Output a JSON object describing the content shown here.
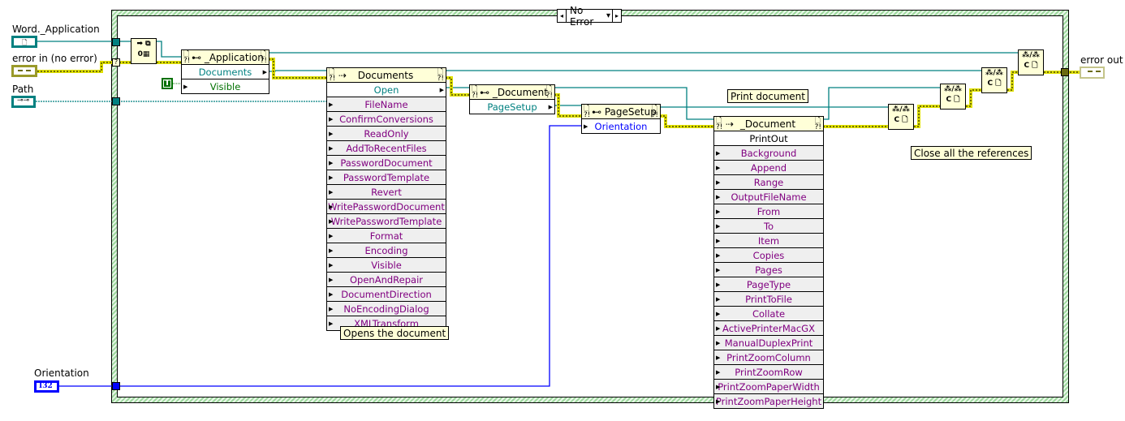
{
  "case_structure": {
    "selector_value": "No Error",
    "left_arrow": "◂",
    "right_arrow": "▸",
    "dropdown": "▾"
  },
  "controls": {
    "word_application": {
      "label": "Word._Application",
      "color": "#008080"
    },
    "error_in": {
      "label": "error in (no error)",
      "color": "#9a9a2a"
    },
    "path": {
      "label": "Path",
      "color": "#008080"
    },
    "orientation": {
      "label": "Orientation",
      "type_badge": "I32",
      "color": "#0000ff"
    }
  },
  "indicators": {
    "error_out": {
      "label": "error out"
    }
  },
  "open_automation": {
    "icon": "open-automation-icon",
    "glyph_top": "➡ ⧉",
    "glyph_bottom": "0▦"
  },
  "true_constant": {
    "text": "T"
  },
  "application_node": {
    "title": "_Application",
    "properties": [
      {
        "name": "Documents",
        "dir": "out"
      },
      {
        "name": "Visible",
        "dir": "in"
      }
    ]
  },
  "documents_node": {
    "title": "Documents",
    "method": "Open",
    "params": [
      "FileName",
      "ConfirmConversions",
      "ReadOnly",
      "AddToRecentFiles",
      "PasswordDocument",
      "PasswordTemplate",
      "Revert",
      "WritePasswordDocument",
      "WritePasswordTemplate",
      "Format",
      "Encoding",
      "Visible",
      "OpenAndRepair",
      "DocumentDirection",
      "NoEncodingDialog",
      "XMLTransform"
    ]
  },
  "document_node": {
    "title": "_Document",
    "properties": [
      {
        "name": "PageSetup"
      }
    ]
  },
  "pagesetup_node": {
    "title": "PageSetup",
    "properties": [
      {
        "name": "Orientation"
      }
    ]
  },
  "printout_node": {
    "title": "_Document",
    "method": "PrintOut",
    "params": [
      "Background",
      "Append",
      "Range",
      "OutputFileName",
      "From",
      "To",
      "Item",
      "Copies",
      "Pages",
      "PageType",
      "PrintToFile",
      "Collate",
      "ActivePrinterMacGX",
      "ManualDuplexPrint",
      "PrintZoomColumn",
      "PrintZoomRow",
      "PrintZoomPaperWidth",
      "PrintZoomPaperHeight"
    ]
  },
  "close_reference": {
    "glyph_top": "⁂/⁂",
    "glyph_bottom": "C 🗋"
  },
  "comments": {
    "open": "Opens the document",
    "print": "Print document",
    "close": "Close all the references"
  },
  "colors": {
    "refnum_wire": "#008080",
    "error_wire": "#e0e000",
    "numeric_wire": "#0000ff",
    "boolean": "#007000",
    "property_text": "#800080",
    "node_header": "#ffffd8",
    "case_border": "#9fd89f"
  }
}
